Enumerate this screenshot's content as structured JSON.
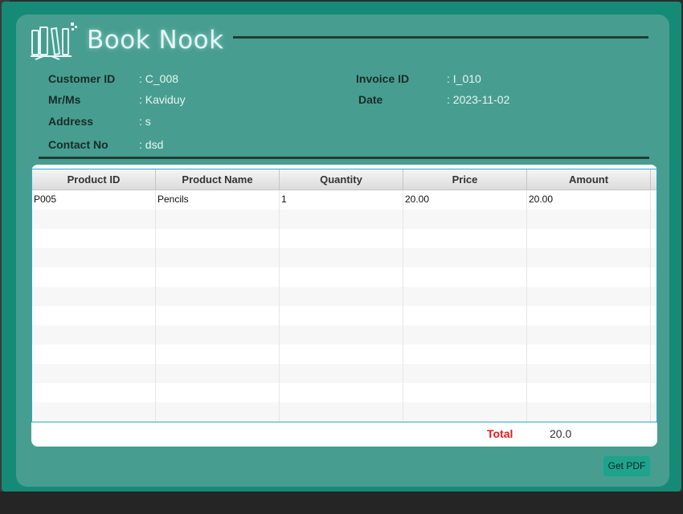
{
  "brand": {
    "name": "Book Nook",
    "icon": "books-icon"
  },
  "customer": {
    "customer_id_label": "Customer ID",
    "customer_id_value": ": C_008",
    "name_label": "Mr/Ms",
    "name_value": ": Kaviduy",
    "address_label": "Address",
    "address_value": ": s",
    "contact_label": "Contact No",
    "contact_value": ": dsd"
  },
  "invoice": {
    "invoice_id_label": "Invoice ID",
    "invoice_id_value": ": I_010",
    "date_label": "Date",
    "date_value": ": 2023-11-02"
  },
  "table": {
    "columns": [
      "Product ID",
      "Product Name",
      "Quantity",
      "Price",
      "Amount"
    ],
    "rows": [
      [
        "P005",
        "Pencils",
        "1",
        "20.00",
        "20.00"
      ]
    ]
  },
  "total": {
    "label": "Total",
    "value": "20.0"
  },
  "actions": {
    "pdf_label": "Get PDF"
  },
  "colors": {
    "accent": "#479e90",
    "total": "#e21b1b",
    "button": "#1ea38d"
  }
}
